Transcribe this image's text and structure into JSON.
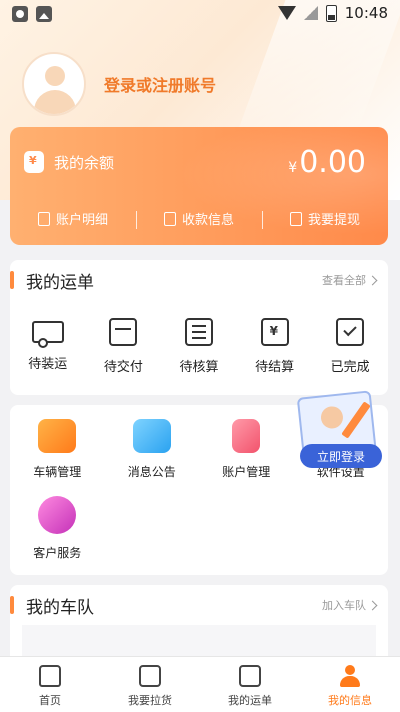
{
  "status_bar": {
    "time": "10:48"
  },
  "profile": {
    "login_text": "登录或注册账号"
  },
  "balance": {
    "label": "我的余额",
    "currency": "¥",
    "amount": "0.00",
    "actions": [
      "账户明细",
      "收款信息",
      "我要提现"
    ]
  },
  "orders": {
    "title": "我的运单",
    "more": "查看全部",
    "items": [
      "待装运",
      "待交付",
      "待核算",
      "待结算",
      "已完成"
    ]
  },
  "tools": {
    "items": [
      "车辆管理",
      "消息公告",
      "账户管理",
      "软件设置",
      "客户服务"
    ]
  },
  "float_login": {
    "label": "立即登录"
  },
  "fleet": {
    "title": "我的车队",
    "more": "加入车队"
  },
  "tabbar": {
    "items": [
      "首页",
      "我要拉货",
      "我的运单",
      "我的信息"
    ],
    "active": "我的信息"
  },
  "colors": {
    "accent": "#ff7a1a",
    "login_button": "#3a63d8"
  }
}
